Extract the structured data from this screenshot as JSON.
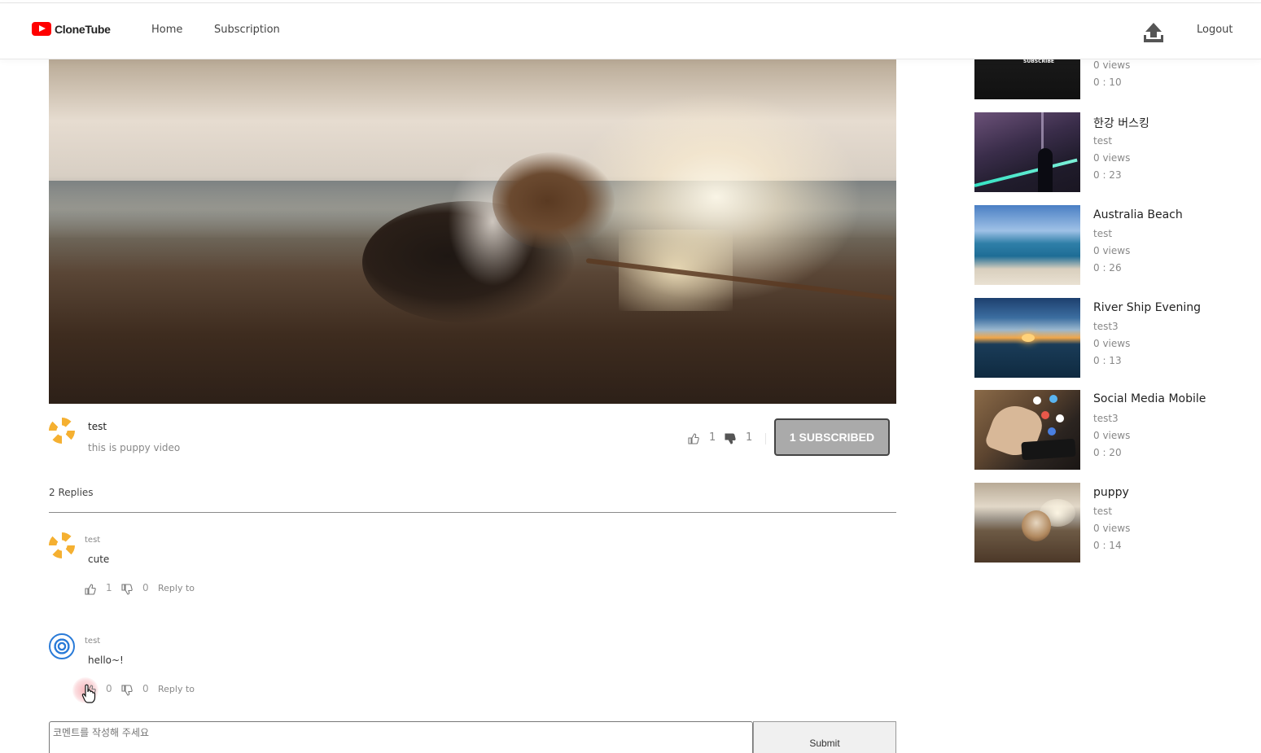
{
  "header": {
    "logo_text": "CloneTube",
    "nav": [
      {
        "label": "Home"
      },
      {
        "label": "Subscription"
      }
    ],
    "upload_icon": "upload-icon",
    "logout_label": "Logout"
  },
  "video": {
    "uploader": "test",
    "description": "this is puppy video",
    "likes": "1",
    "dislikes": "1",
    "subscribe_label": "1 SUBSCRIBED"
  },
  "comments": {
    "count_label": "2 Replies",
    "items": [
      {
        "author": "test",
        "text": "cute",
        "likes": "1",
        "dislikes": "0",
        "reply_label": "Reply to"
      },
      {
        "author": "test",
        "text": "hello~!",
        "likes": "0",
        "dislikes": "0",
        "reply_label": "Reply to"
      }
    ],
    "input_placeholder": "코멘트를 작성해 주세요",
    "submit_label": "Submit"
  },
  "sidebar": {
    "items": [
      {
        "title": "",
        "user": "",
        "views": "0 views",
        "duration": "0 : 10",
        "thumb_text": "SUBSCRIBE"
      },
      {
        "title": "한강 버스킹",
        "user": "test",
        "views": "0 views",
        "duration": "0 : 23"
      },
      {
        "title": "Australia Beach",
        "user": "test",
        "views": "0 views",
        "duration": "0 : 26"
      },
      {
        "title": "River Ship Evening",
        "user": "test3",
        "views": "0 views",
        "duration": "0 : 13"
      },
      {
        "title": "Social Media Mobile",
        "user": "test3",
        "views": "0 views",
        "duration": "0 : 20"
      },
      {
        "title": "puppy",
        "user": "test",
        "views": "0 views",
        "duration": "0 : 14"
      }
    ]
  },
  "colors": {
    "brand_red": "#ff0000",
    "subscribed_bg": "#aaaaaa",
    "avatar_yellow": "#f5b031",
    "avatar_blue": "#2a7bd8"
  }
}
